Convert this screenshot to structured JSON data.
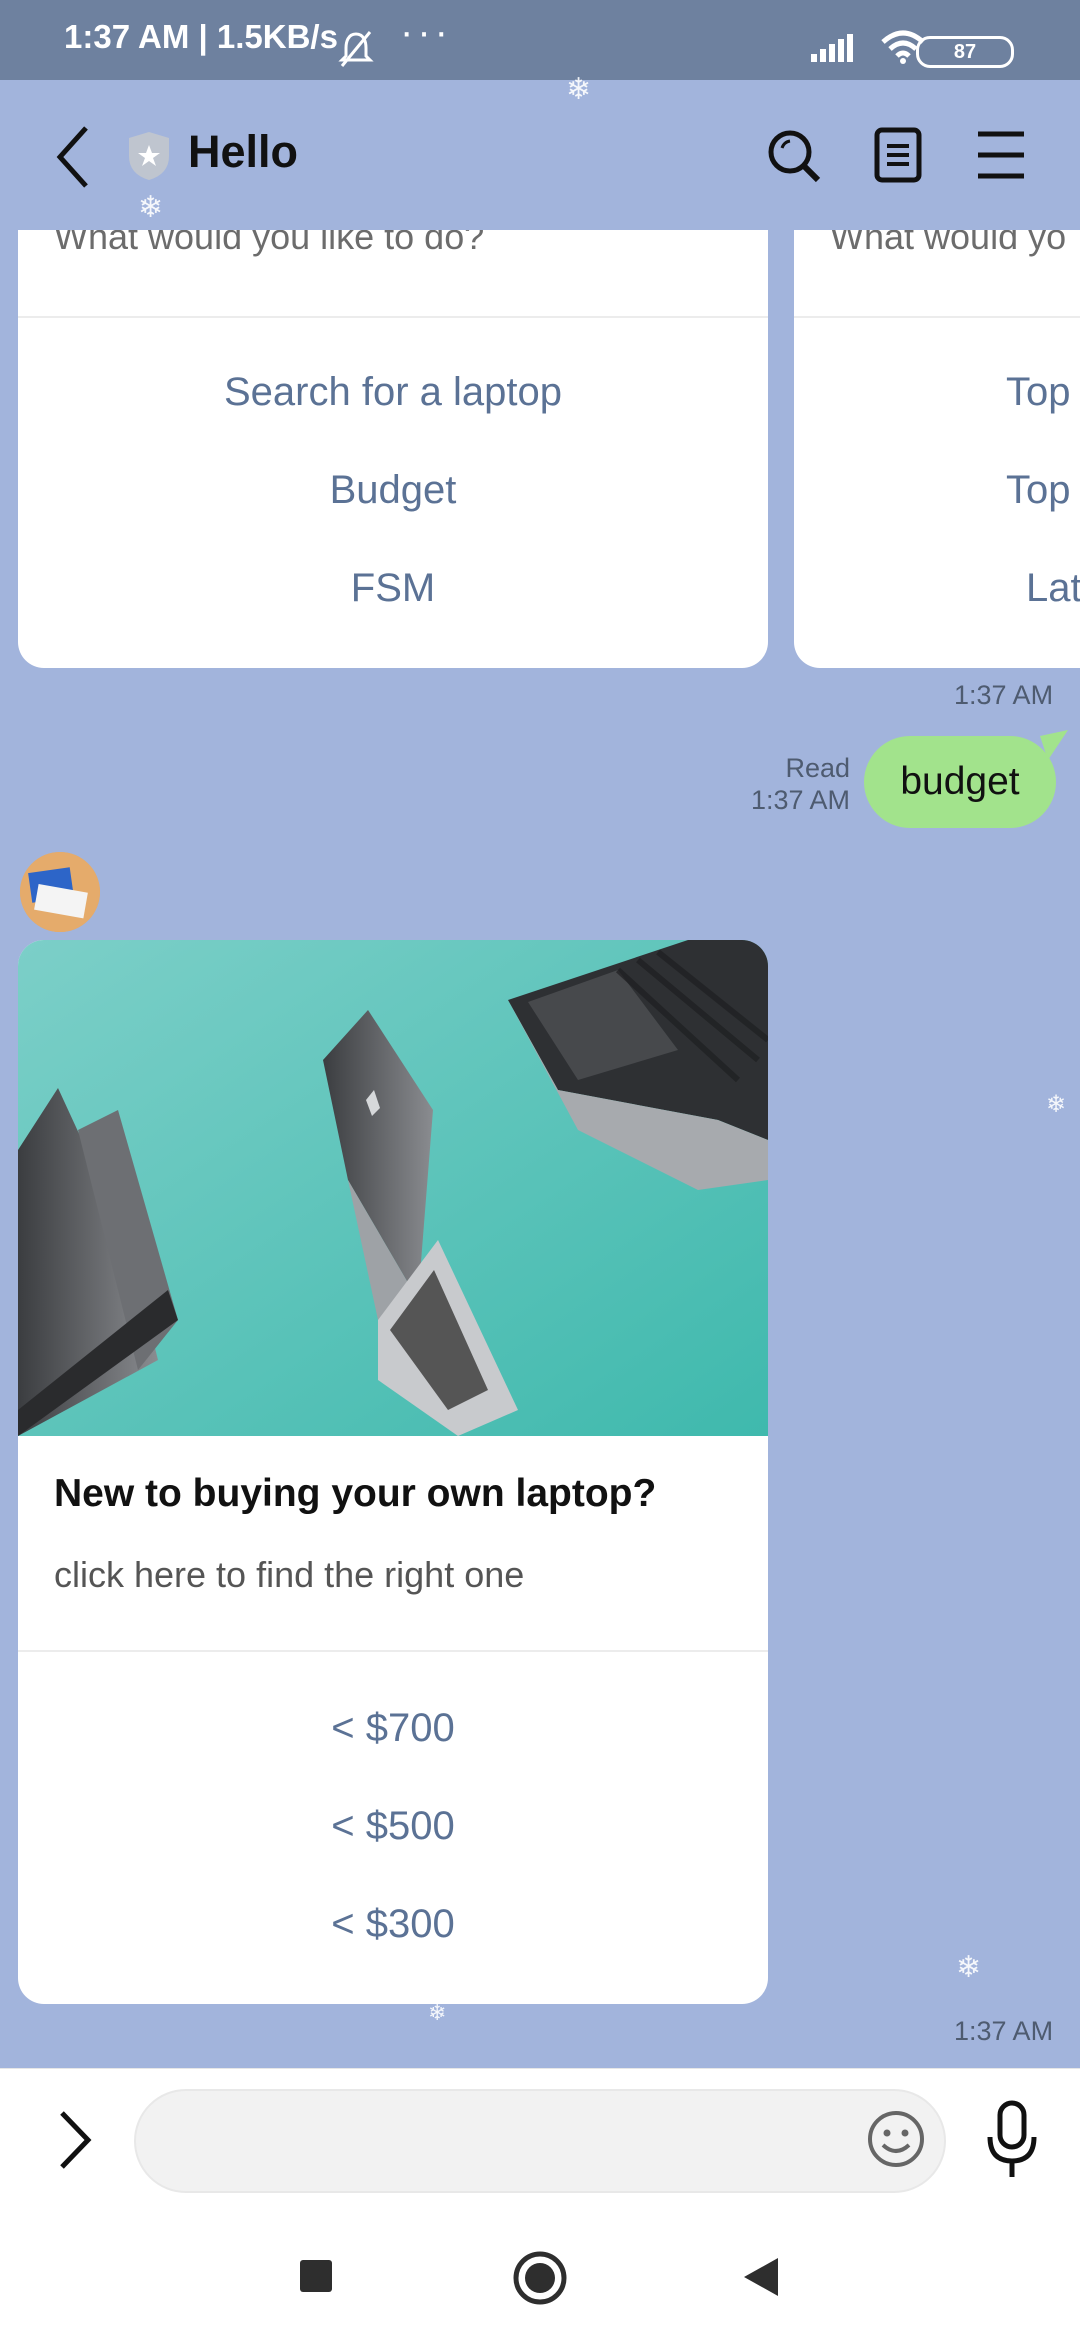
{
  "status_bar": {
    "time_speed": "1:37 AM | 1.5KB/s",
    "dots": "···",
    "battery": "87"
  },
  "header": {
    "title": "Hello"
  },
  "card1": {
    "question": "What would you like to do?",
    "actions": [
      "Search for a laptop",
      "Budget",
      "FSM"
    ]
  },
  "card2": {
    "question": "What would yo",
    "actions": [
      "Top",
      "Top",
      "Lat"
    ]
  },
  "card_time": "1:37 AM",
  "user_message": {
    "text": "budget",
    "read_label": "Read",
    "time": "1:37 AM"
  },
  "product_card": {
    "title": "New to buying your own laptop?",
    "subtitle": "click here to find the right one",
    "actions": [
      "< $700",
      "< $500",
      "< $300"
    ],
    "time": "1:37 AM"
  },
  "input": {
    "placeholder": ""
  }
}
